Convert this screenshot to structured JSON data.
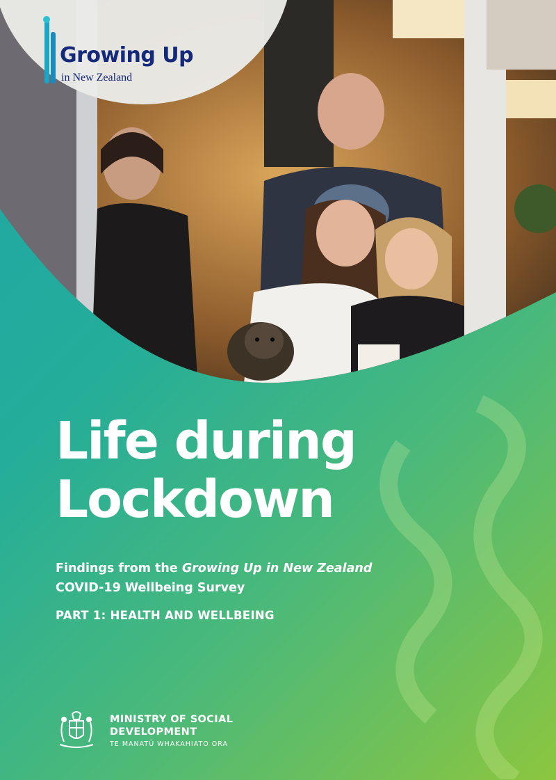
{
  "brand": {
    "logo_title": "Growing Up",
    "logo_subtitle": "in New Zealand"
  },
  "cover": {
    "photo": "family-standing-in-doorway-with-dog",
    "title_line1": "Life during",
    "title_line2": "Lockdown",
    "subtitle_prefix": "Findings from the ",
    "subtitle_italic": "Growing Up in New Zealand",
    "subtitle_line2": "COVID-19 Wellbeing Survey",
    "part": "PART 1: HEALTH AND WELLBEING"
  },
  "publisher": {
    "name_line1": "MINISTRY OF SOCIAL",
    "name_line2": "DEVELOPMENT",
    "maori_name": "TE MANATŪ WHAKAHIATO ORA",
    "crest_icon": "nz-coat-of-arms-icon"
  },
  "colors": {
    "brand_navy": "#15297a",
    "gradient_start": "#1fa6a8",
    "gradient_end": "#8cc63f"
  }
}
